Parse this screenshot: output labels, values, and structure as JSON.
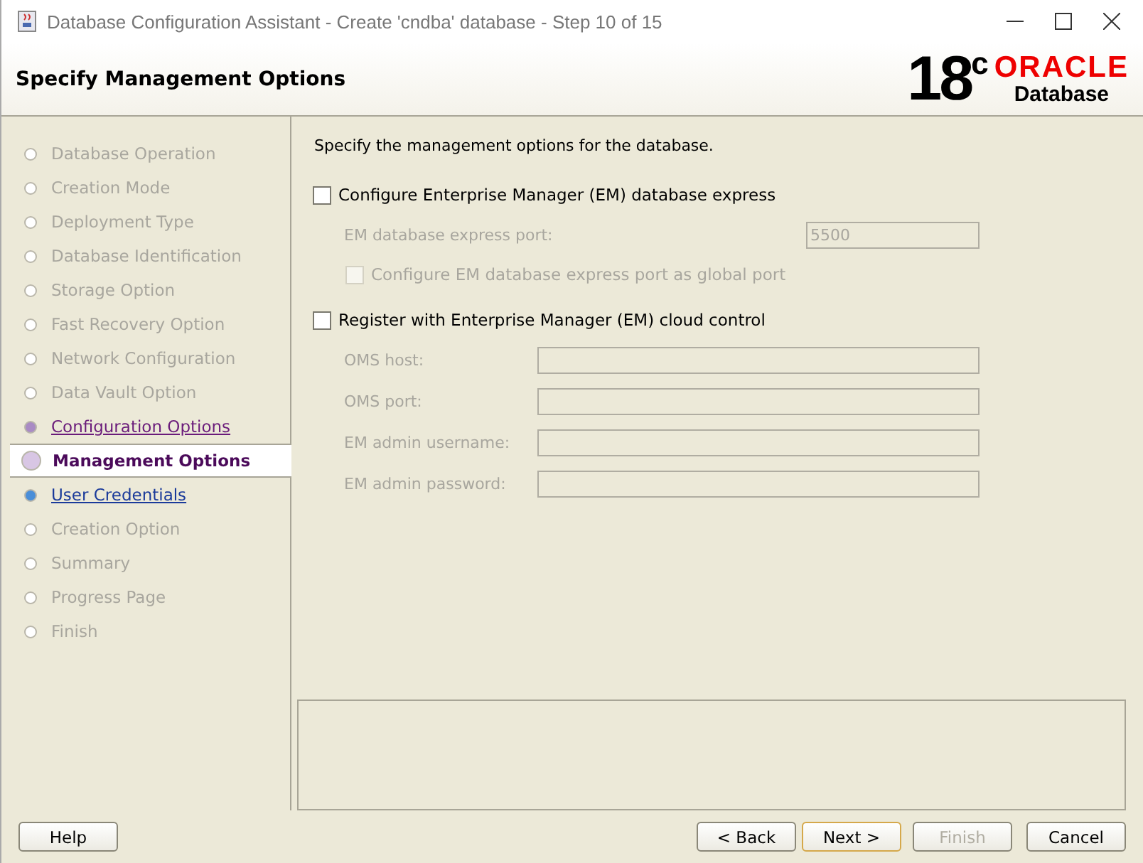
{
  "window": {
    "title": "Database Configuration Assistant - Create 'cndba' database - Step 10 of 15"
  },
  "header": {
    "title": "Specify Management Options",
    "version": "18",
    "version_sup": "c",
    "brand": "ORACLE",
    "product": "Database"
  },
  "steps": [
    {
      "label": "Database Operation",
      "kind": "pending"
    },
    {
      "label": "Creation Mode",
      "kind": "pending"
    },
    {
      "label": "Deployment Type",
      "kind": "pending"
    },
    {
      "label": "Database Identification",
      "kind": "pending"
    },
    {
      "label": "Storage Option",
      "kind": "pending"
    },
    {
      "label": "Fast Recovery Option",
      "kind": "pending"
    },
    {
      "label": "Network Configuration",
      "kind": "pending"
    },
    {
      "label": "Data Vault Option",
      "kind": "pending"
    },
    {
      "label": "Configuration Options",
      "kind": "visited"
    },
    {
      "label": "Management Options",
      "kind": "current"
    },
    {
      "label": "User Credentials",
      "kind": "next"
    },
    {
      "label": "Creation Option",
      "kind": "pending"
    },
    {
      "label": "Summary",
      "kind": "pending"
    },
    {
      "label": "Progress Page",
      "kind": "pending"
    },
    {
      "label": "Finish",
      "kind": "pending"
    }
  ],
  "intro": "Specify the management options for the database.",
  "em_express": {
    "label": "Configure Enterprise Manager (EM) database express",
    "checked": false,
    "port_label": "EM database express port:",
    "port_value": "5500",
    "disabled": true,
    "global_label": "Configure EM database express port as global port",
    "global_checked": false
  },
  "cloud_control": {
    "label": "Register with Enterprise Manager (EM) cloud control",
    "checked": false,
    "disabled": true,
    "fields": [
      {
        "label": "OMS host:"
      },
      {
        "label": "OMS port:"
      },
      {
        "label": "EM admin username:"
      },
      {
        "label": "EM admin password:"
      }
    ]
  },
  "buttons": [
    {
      "label": "Help",
      "disabled": false,
      "default": false
    },
    {
      "label": "< Back",
      "disabled": false,
      "default": false
    },
    {
      "label": "Next >",
      "disabled": false,
      "default": true
    },
    {
      "label": "Finish",
      "disabled": true,
      "default": false
    },
    {
      "label": "Cancel",
      "disabled": false,
      "default": false
    }
  ]
}
